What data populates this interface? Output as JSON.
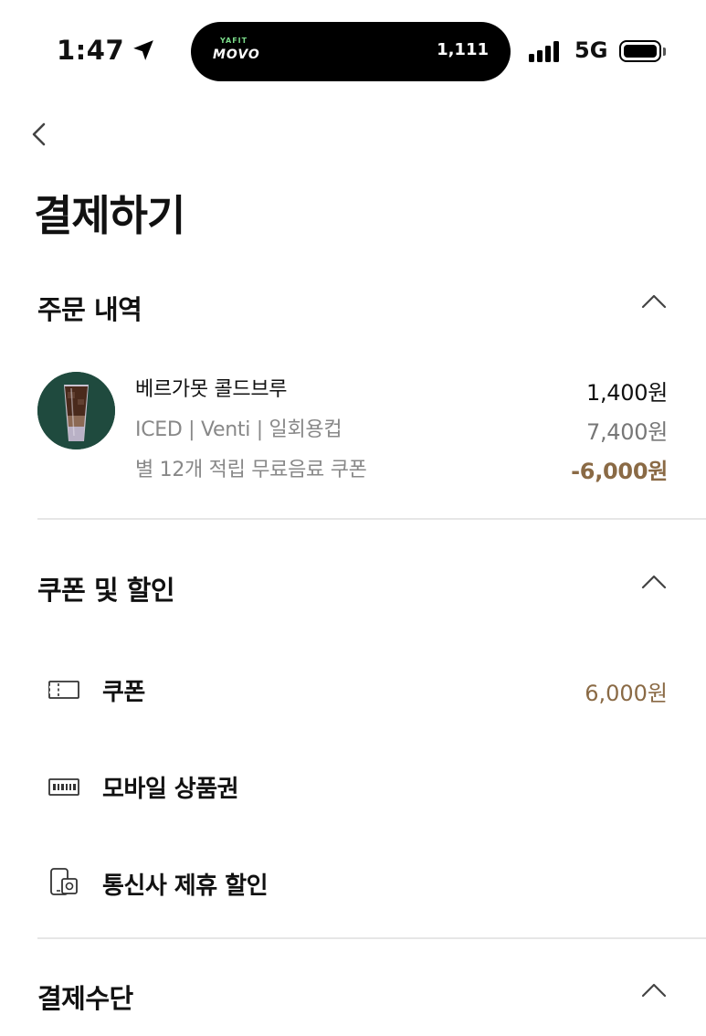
{
  "status_bar": {
    "time": "1:47",
    "island_brand_top": "YAFIT",
    "island_brand": "MOVO",
    "island_count": "1,111",
    "network": "5G"
  },
  "header": {
    "title": "결제하기"
  },
  "order_section": {
    "title": "주문 내역",
    "item": {
      "name": "베르가못 콜드브루",
      "options": "ICED | Venti | 일회용컵",
      "coupon_desc": "별 12개 적립 무료음료 쿠폰",
      "price_extra": "1,400원",
      "price_base": "7,400원",
      "discount": "-6,000원"
    }
  },
  "discount_section": {
    "title": "쿠폰 및 할인",
    "items": [
      {
        "label": "쿠폰",
        "value": "6,000원",
        "icon": "coupon-ticket-icon"
      },
      {
        "label": "모바일 상품권",
        "value": "",
        "icon": "gift-card-icon"
      },
      {
        "label": "통신사 제휴 할인",
        "value": "",
        "icon": "phone-discount-icon"
      }
    ]
  },
  "payment_section": {
    "title": "결제수단"
  },
  "colors": {
    "accent_brown": "#8a6a45",
    "product_bg": "#1f4a3e",
    "divider": "#e6e6e6"
  }
}
